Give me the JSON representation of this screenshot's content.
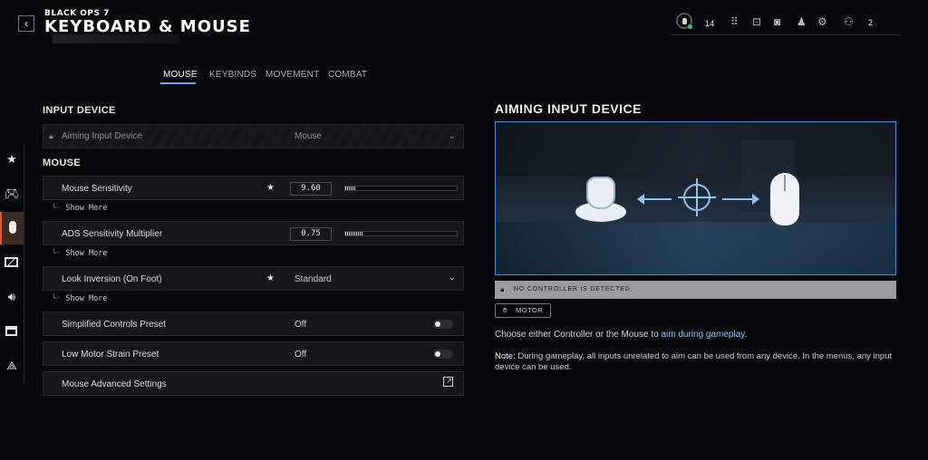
{
  "header": {
    "brand": "BLACK OPS 7",
    "title": "KEYBOARD & MOUSE",
    "back_icon": "chevron-left-icon",
    "level": "14",
    "party_count": "2"
  },
  "tabs": [
    {
      "label": "MOUSE",
      "active": true
    },
    {
      "label": "KEYBINDS",
      "active": false
    },
    {
      "label": "MOVEMENT",
      "active": false
    },
    {
      "label": "COMBAT",
      "active": false
    }
  ],
  "rail": [
    "star-icon",
    "gamepad-icon",
    "mouse-icon",
    "display-icon",
    "audio-icon",
    "interface-icon",
    "network-icon"
  ],
  "input_device": {
    "section_title": "INPUT DEVICE",
    "label": "Aiming Input Device",
    "value": "Mouse"
  },
  "mouse": {
    "section_title": "MOUSE",
    "sensitivity": {
      "label": "Mouse Sensitivity",
      "value": "9.60",
      "level": 0.1
    },
    "ads": {
      "label": "ADS Sensitivity Multiplier",
      "value": "0.75",
      "level": 0.16
    },
    "look_inversion": {
      "label": "Look Inversion (On Foot)",
      "value": "Standard"
    },
    "simplified": {
      "label": "Simplified Controls Preset",
      "value": "Off"
    },
    "low_motor": {
      "label": "Low Motor Strain Preset",
      "value": "Off"
    },
    "advanced": {
      "label": "Mouse Advanced Settings"
    },
    "show_more": "Show More"
  },
  "panel": {
    "title": "AIMING INPUT DEVICE",
    "status": "NO CONTROLLER IS DETECTED.",
    "chip": "MOTOR",
    "desc_prefix": "Choose either Controller or the Mouse to ",
    "desc_link": "aim during gameplay",
    "desc_suffix": ".",
    "note_label": "Note:",
    "note_text": " During gameplay, all inputs unrelated to aim can be used from any device. In the menus, any input device can be used."
  },
  "colors": {
    "accent": "#6aa8ff",
    "rail_active": "#e35b2c",
    "link": "#8ec4f6",
    "preview_border": "#4a8fd9"
  }
}
